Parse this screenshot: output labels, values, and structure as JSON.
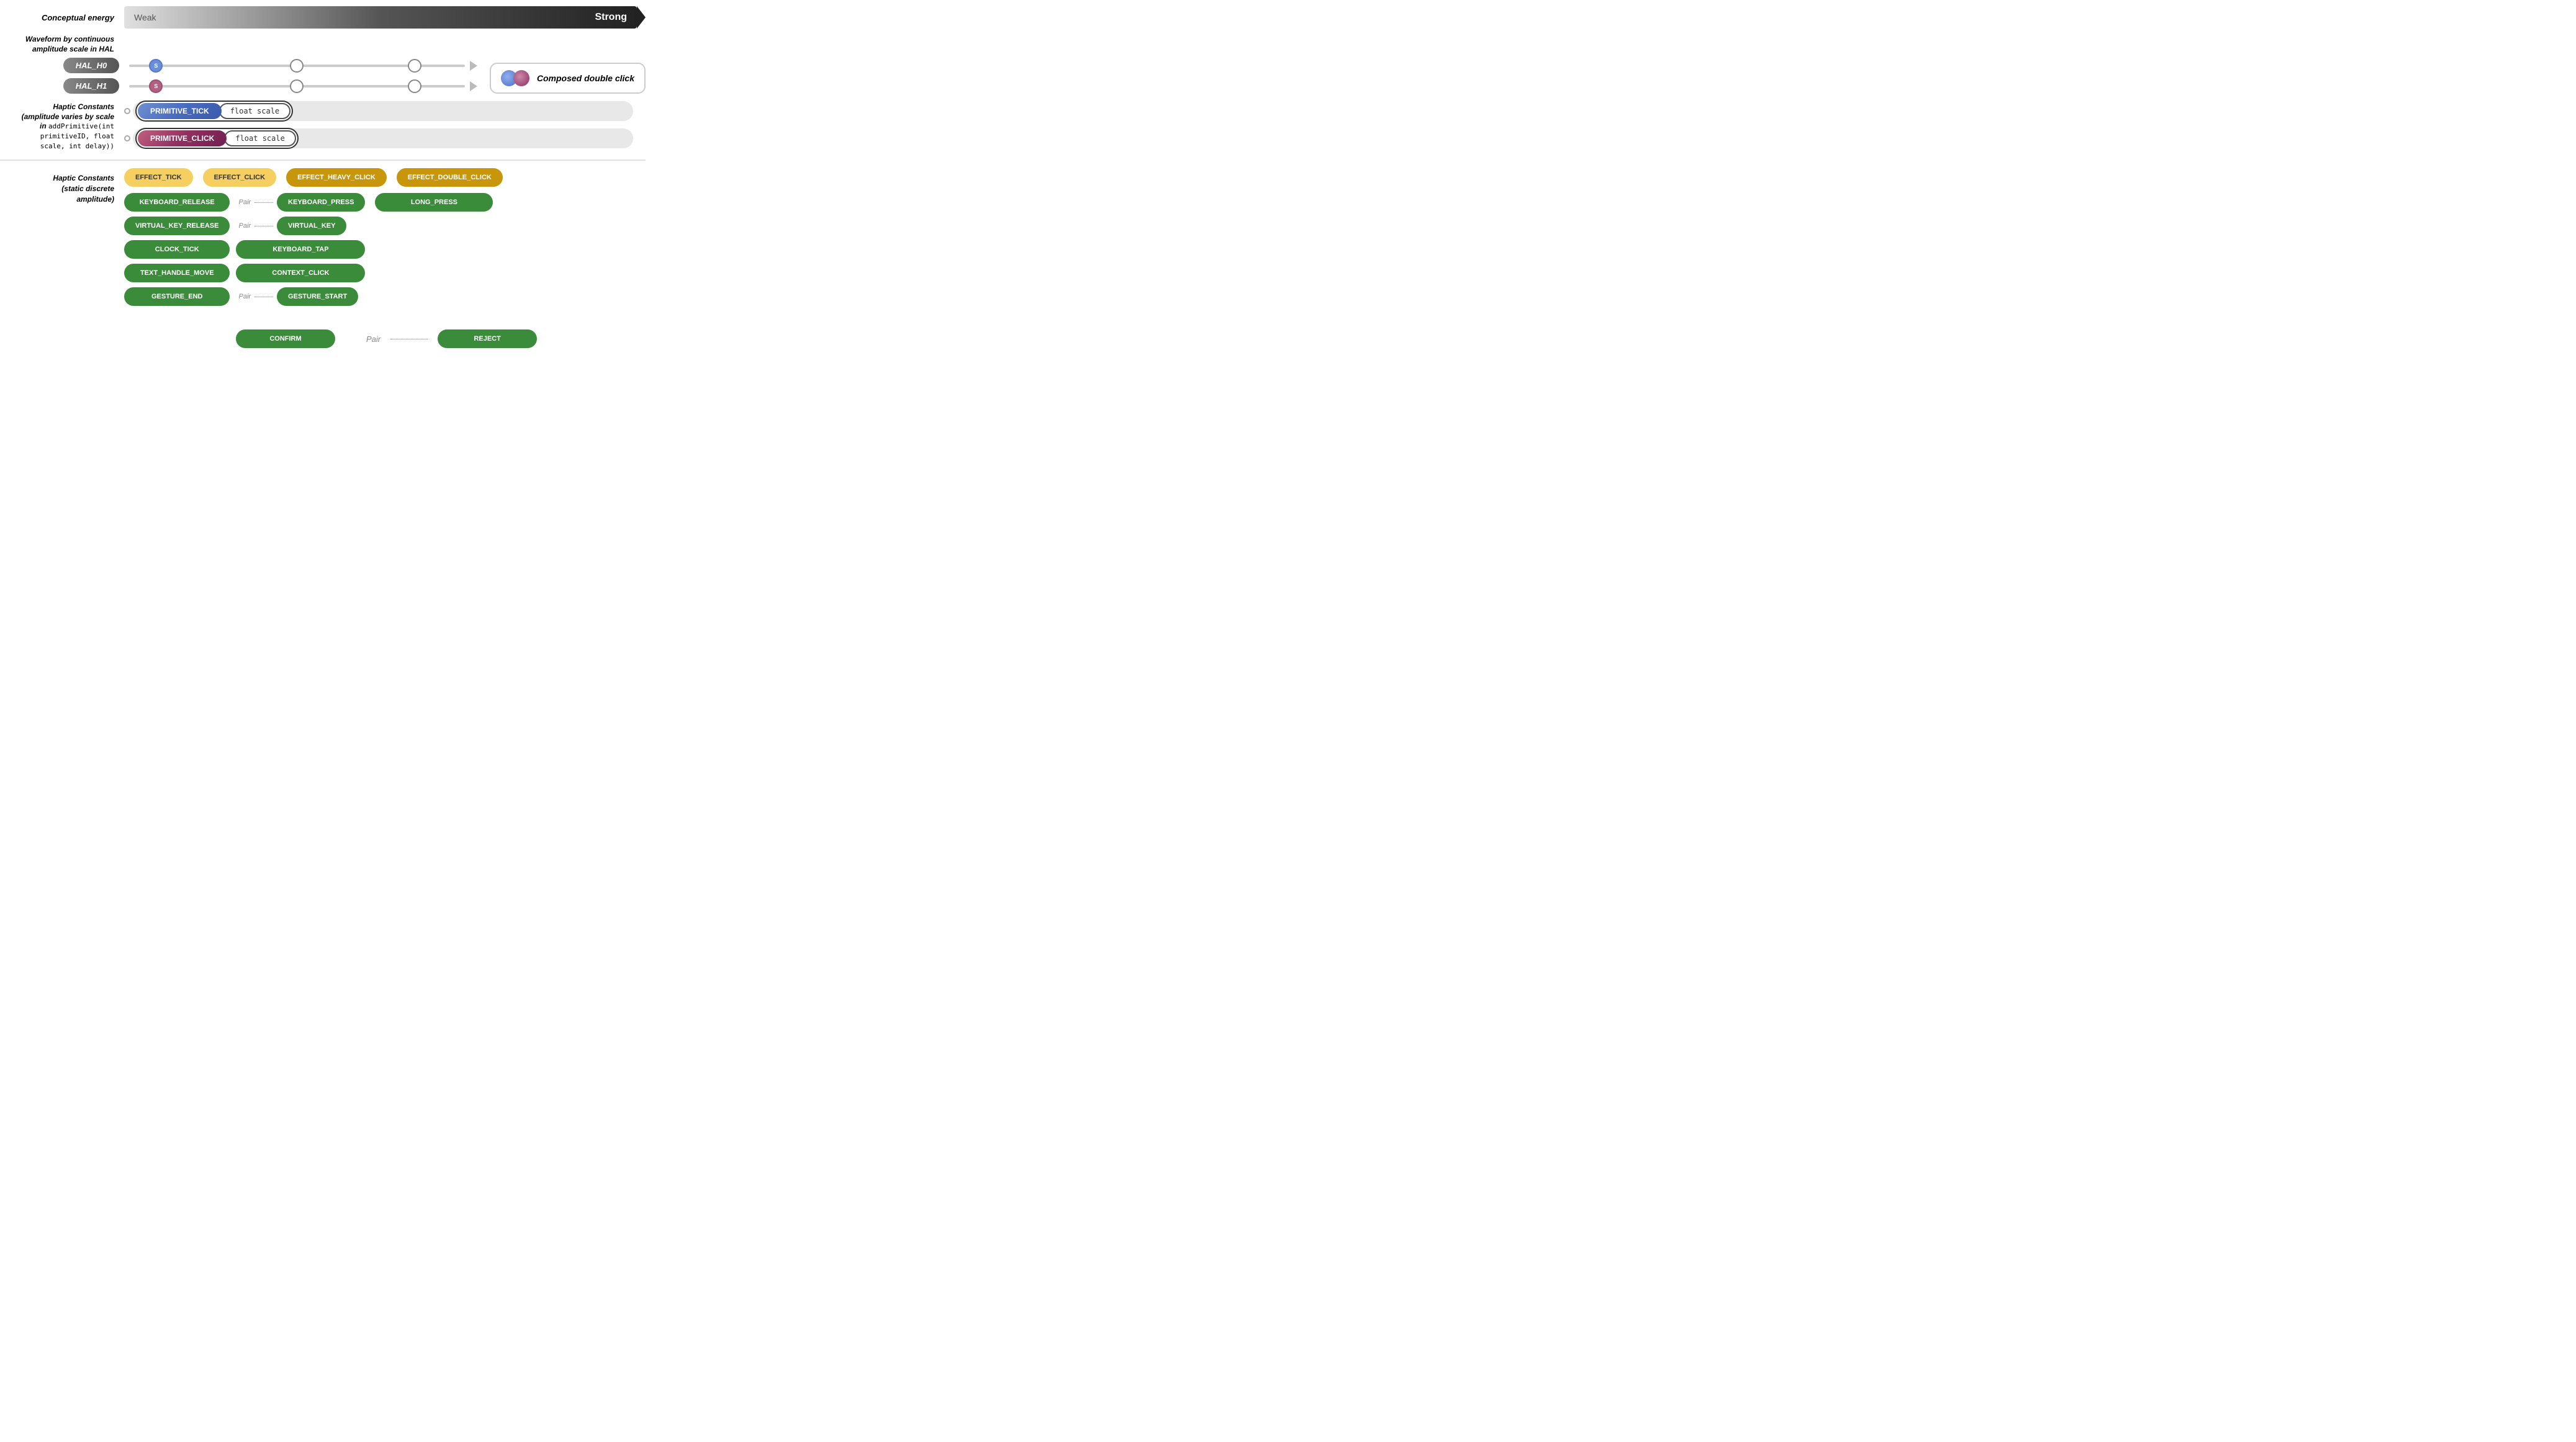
{
  "energy": {
    "label": "Conceptual energy",
    "weak": "Weak",
    "strong": "Strong"
  },
  "waveform": {
    "label": "Waveform by continuous amplitude scale in HAL"
  },
  "hal": {
    "h0": {
      "label": "HAL_H0",
      "dot_label": "S"
    },
    "h1": {
      "label": "HAL_H1",
      "dot_label": "S"
    }
  },
  "composed_legend": {
    "text": "Composed double click"
  },
  "haptic_primitives": {
    "label": "Haptic Constants (amplitude varies by scale in addPrimitive(int primitiveID, float scale, int delay))",
    "primitive_tick": "PRIMITIVE_TICK",
    "float_scale_tick": "float scale",
    "primitive_click": "PRIMITIVE_CLICK",
    "float_scale_click": "float scale"
  },
  "haptic_constants": {
    "label": "Haptic Constants (static discrete amplitude)",
    "effects": {
      "effect_tick": "EFFECT_TICK",
      "effect_click": "EFFECT_CLICK",
      "effect_heavy_click": "EFFECT_HEAVY_CLICK",
      "effect_double_click": "EFFECT_DOUBLE_CLICK"
    },
    "col1": [
      {
        "label": "KEYBOARD_RELEASE",
        "type": "green"
      },
      {
        "label": "VIRTUAL_KEY_RELEASE",
        "type": "green"
      },
      {
        "label": "CLOCK_TICK",
        "type": "green"
      },
      {
        "label": "TEXT_HANDLE_MOVE",
        "type": "green"
      },
      {
        "label": "GESTURE_END",
        "type": "green"
      }
    ],
    "col2_pairs": [
      {
        "pair_label": "Pair",
        "label": "KEYBOARD_PRESS",
        "type": "green"
      },
      {
        "pair_label": "Pair",
        "label": "VIRTUAL_KEY",
        "type": "green"
      },
      {
        "label": "KEYBOARD_TAP",
        "type": "green"
      },
      {
        "label": "CONTEXT_CLICK",
        "type": "green"
      },
      {
        "pair_label": "Pair",
        "label": "GESTURE_START",
        "type": "green"
      }
    ],
    "col3": [
      {
        "label": "LONG_PRESS",
        "type": "green"
      }
    ],
    "confirm": "CONFIRM",
    "pair_label_confirm": "Pair",
    "reject": "REJECT"
  }
}
